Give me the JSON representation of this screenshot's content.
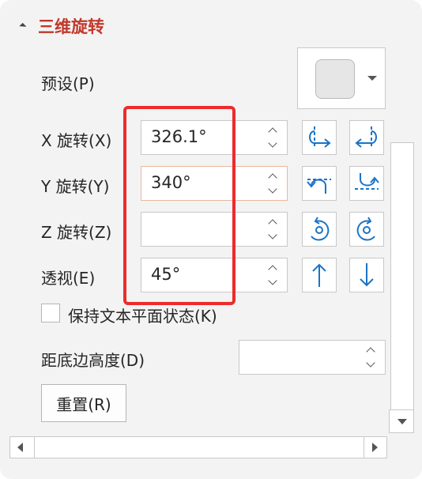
{
  "section": {
    "title": "三维旋转"
  },
  "preset": {
    "label": "预设(P)"
  },
  "rows": [
    {
      "label": "X 旋转(X)",
      "value": "326.1°"
    },
    {
      "label": "Y 旋转(Y)",
      "value": "340°"
    },
    {
      "label": "Z 旋转(Z)",
      "value": ""
    },
    {
      "label": "透视(E)",
      "value": "45°"
    }
  ],
  "keep_flat": {
    "label": "保持文本平面状态(K)",
    "checked": false
  },
  "distance": {
    "label": "距底边高度(D)",
    "value": ""
  },
  "reset": {
    "label": "重置(R)"
  },
  "colors": {
    "accent": "#c0392b",
    "icon_blue": "#1a73c7",
    "highlight": "#ee2b2b"
  }
}
